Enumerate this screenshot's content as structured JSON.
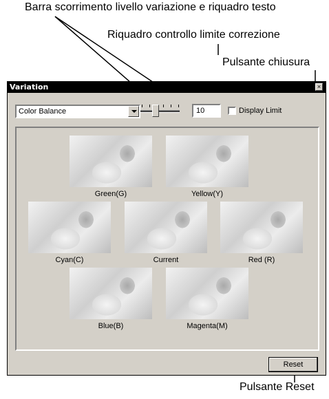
{
  "callouts": {
    "slider_and_text": "Barra scorrimento livello variazione e riquadro testo",
    "limit_checkbox": "Riquadro controllo limite correzione",
    "close_button": "Pulsante chiusura",
    "reset_button": "Pulsante Reset"
  },
  "window": {
    "title": "Variation",
    "close_glyph": "×",
    "mode": "Color Balance",
    "level_value": "10",
    "display_limit_label": "Display Limit",
    "display_limit_checked": false,
    "reset_label": "Reset"
  },
  "thumbnails": [
    {
      "label": "Green(G)"
    },
    {
      "label": "Yellow(Y)"
    },
    {
      "label": "Cyan(C)"
    },
    {
      "label": "Current"
    },
    {
      "label": "Red (R)"
    },
    {
      "label": "Blue(B)"
    },
    {
      "label": "Magenta(M)"
    }
  ],
  "colors": {
    "window_bg": "#d4d0c8",
    "titlebar_bg": "#000000"
  }
}
